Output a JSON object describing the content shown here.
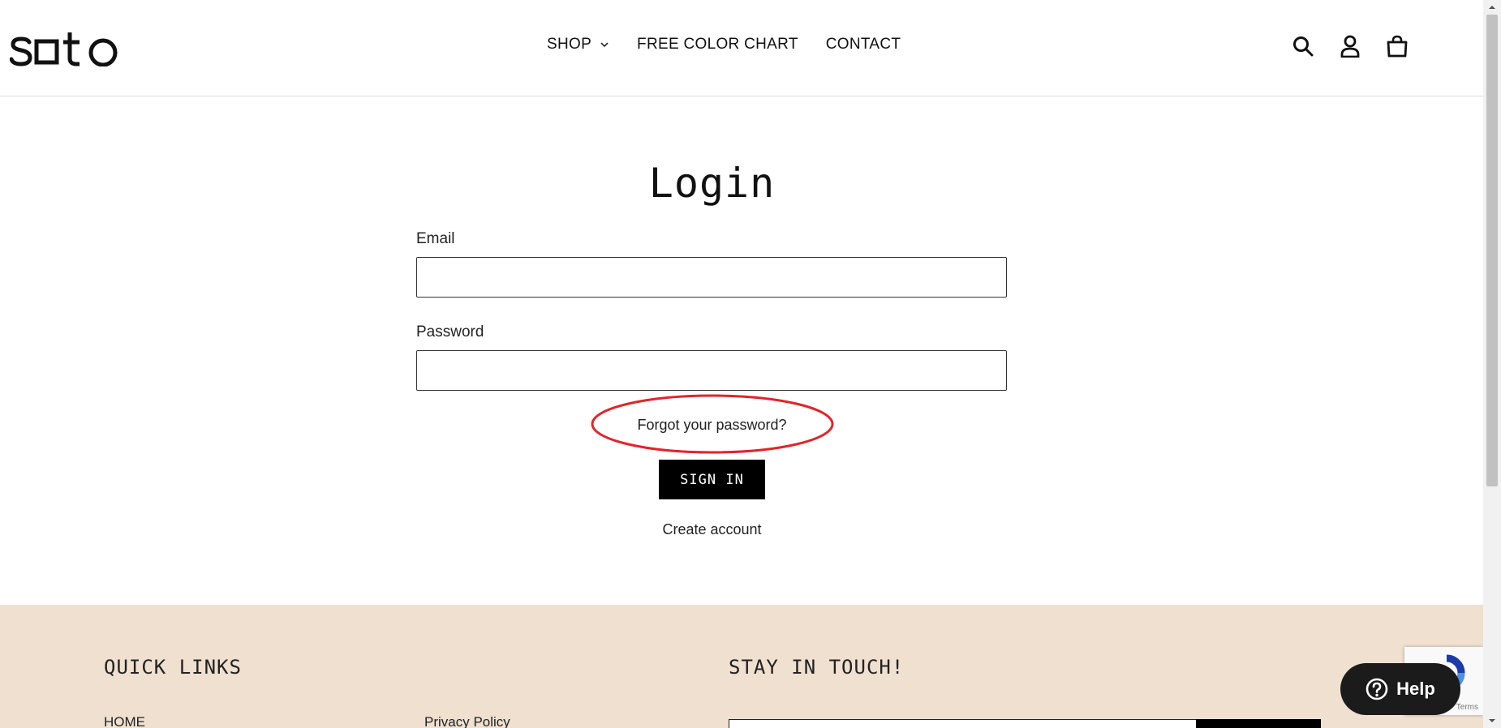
{
  "header": {
    "logo_text": "soto",
    "nav": [
      {
        "label": "SHOP",
        "has_dropdown": true
      },
      {
        "label": "FREE COLOR CHART"
      },
      {
        "label": "CONTACT"
      }
    ],
    "icons": [
      "search-icon",
      "account-icon",
      "cart-icon"
    ]
  },
  "main": {
    "title": "Login",
    "email_label": "Email",
    "email_value": "",
    "password_label": "Password",
    "password_value": "",
    "forgot_link": "Forgot your password?",
    "signin_button": "SIGN IN",
    "create_account": "Create account",
    "annotation_color": "#e0252b"
  },
  "footer": {
    "quick_links_heading": "QUICK LINKS",
    "stay_in_touch_heading": "STAY IN TOUCH!",
    "links": [
      "HOME",
      "Privacy Policy"
    ],
    "background": "#f0e0d0"
  },
  "widgets": {
    "help_label": "Help",
    "recaptcha_terms": "Terms"
  }
}
